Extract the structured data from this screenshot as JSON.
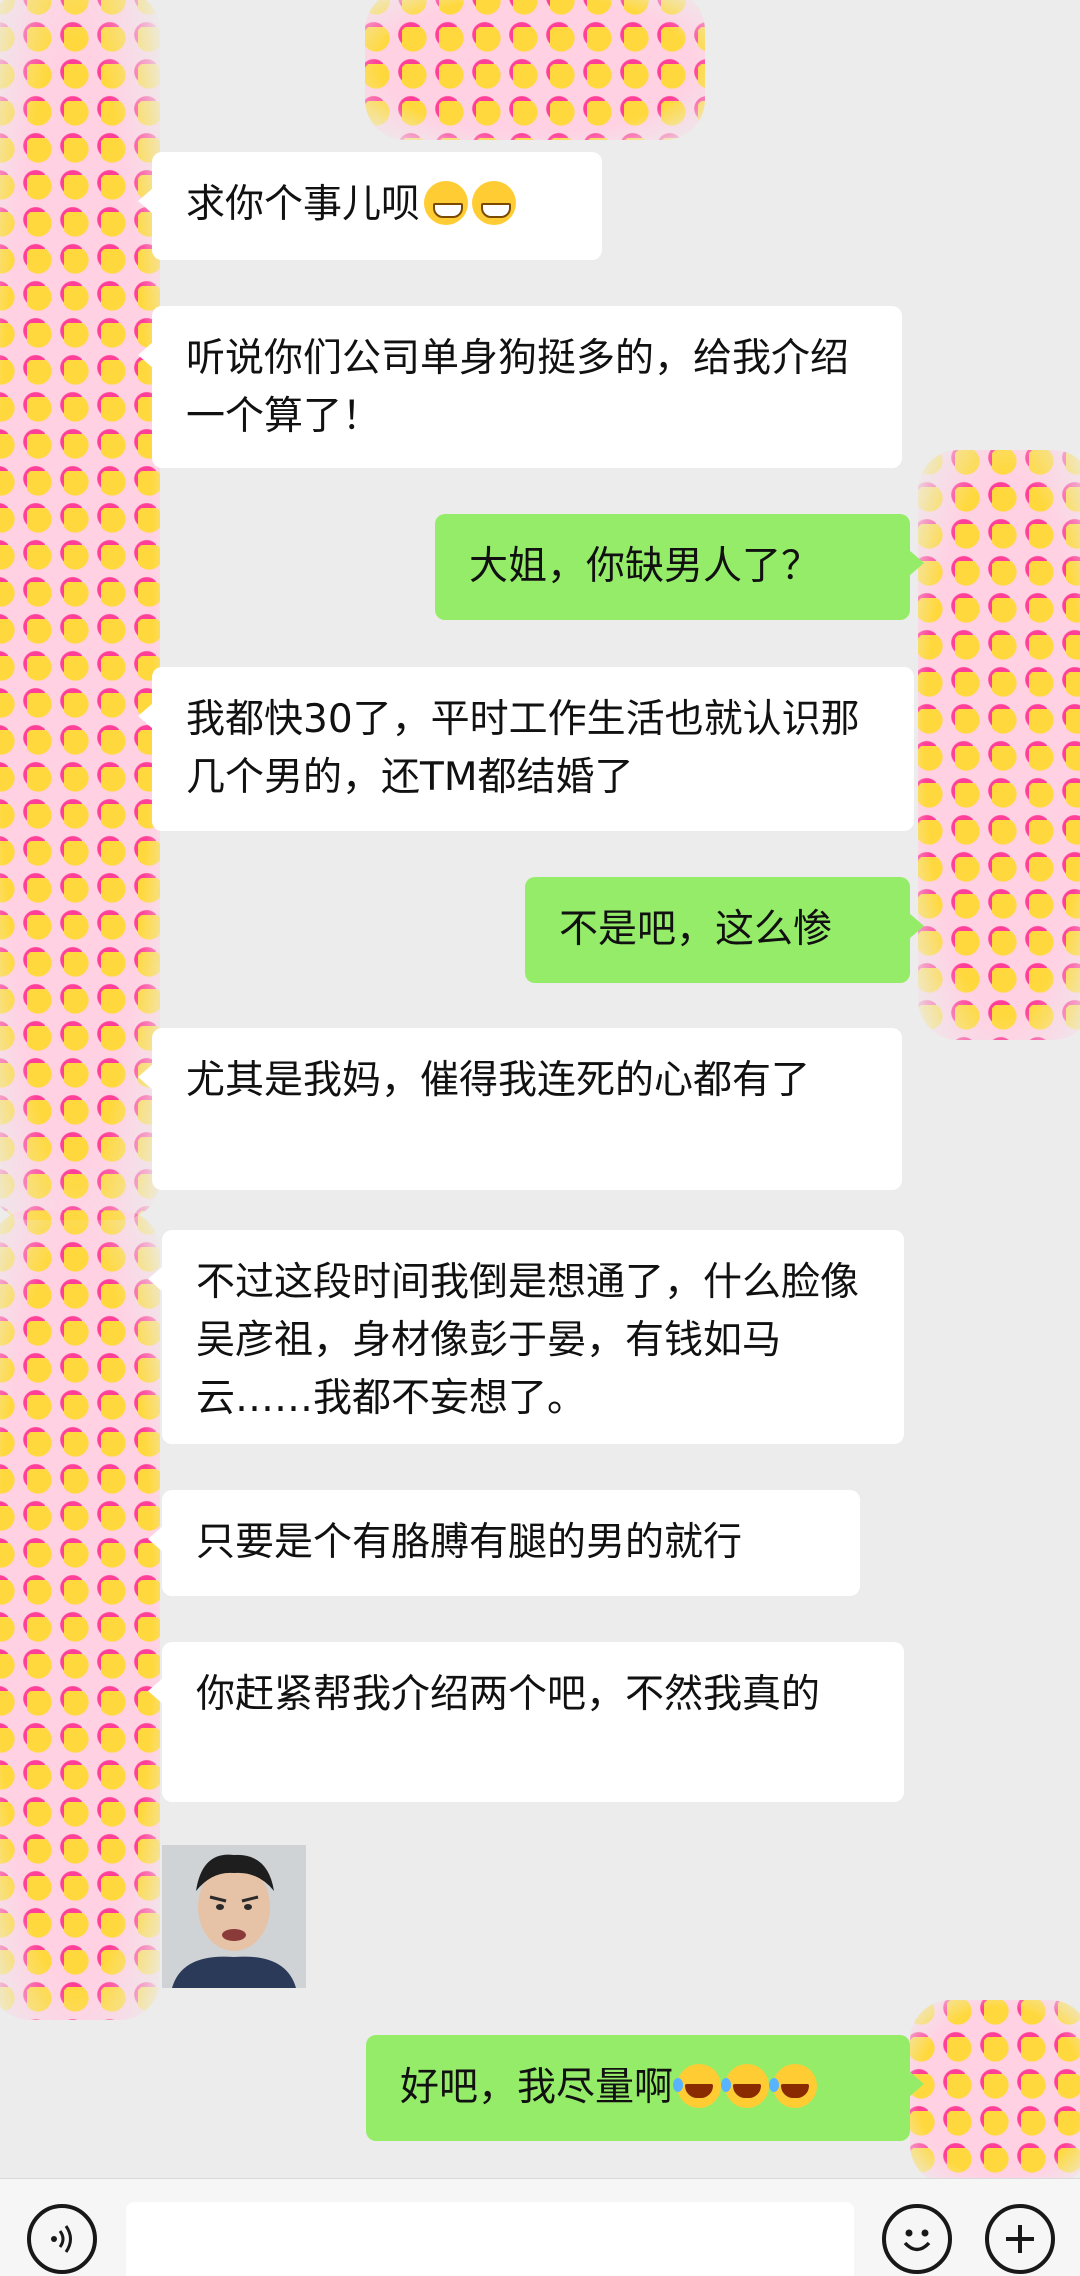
{
  "conversation": {
    "messages": [
      {
        "side": "in",
        "text": "求你个事儿呗",
        "emoji": [
          "grinning-face-icon",
          "grinning-face-icon"
        ]
      },
      {
        "side": "in",
        "text": "听说你们公司单身狗挺多的，给我介绍一个算了！"
      },
      {
        "side": "out",
        "text": "大姐，你缺男人了？"
      },
      {
        "side": "in",
        "text": "我都快30了，平时工作生活也就认识那几个男的，还TM都结婚了"
      },
      {
        "side": "out",
        "text": "不是吧，这么惨"
      },
      {
        "side": "in",
        "text": "尤其是我妈，催得我连死的心都有了"
      },
      {
        "side": "in",
        "text": "不过这段时间我倒是想通了，什么脸像吴彦祖，身材像彭于晏，有钱如马云……我都不妄想了。"
      },
      {
        "side": "in",
        "text": "只要是个有胳膊有腿的男的就行"
      },
      {
        "side": "in",
        "text": "你赶紧帮我介绍两个吧，不然我真的"
      },
      {
        "side": "in",
        "type": "image",
        "description": "reaction-meme-icon"
      },
      {
        "side": "out",
        "text": "好吧，我尽量啊",
        "emoji": [
          "laughing-crying-face-icon",
          "laughing-crying-face-icon",
          "laughing-crying-face-icon"
        ]
      }
    ]
  },
  "input_bar": {
    "voice_icon": "voice-icon",
    "emoji_icon": "emoji-icon",
    "plus_icon": "plus-icon",
    "placeholder": ""
  },
  "colors": {
    "background": "#ececec",
    "incoming_bubble": "#ffffff",
    "outgoing_bubble": "#95ec69",
    "avatar_yellow": "#ffd83d",
    "avatar_pink": "#ff3f98"
  }
}
